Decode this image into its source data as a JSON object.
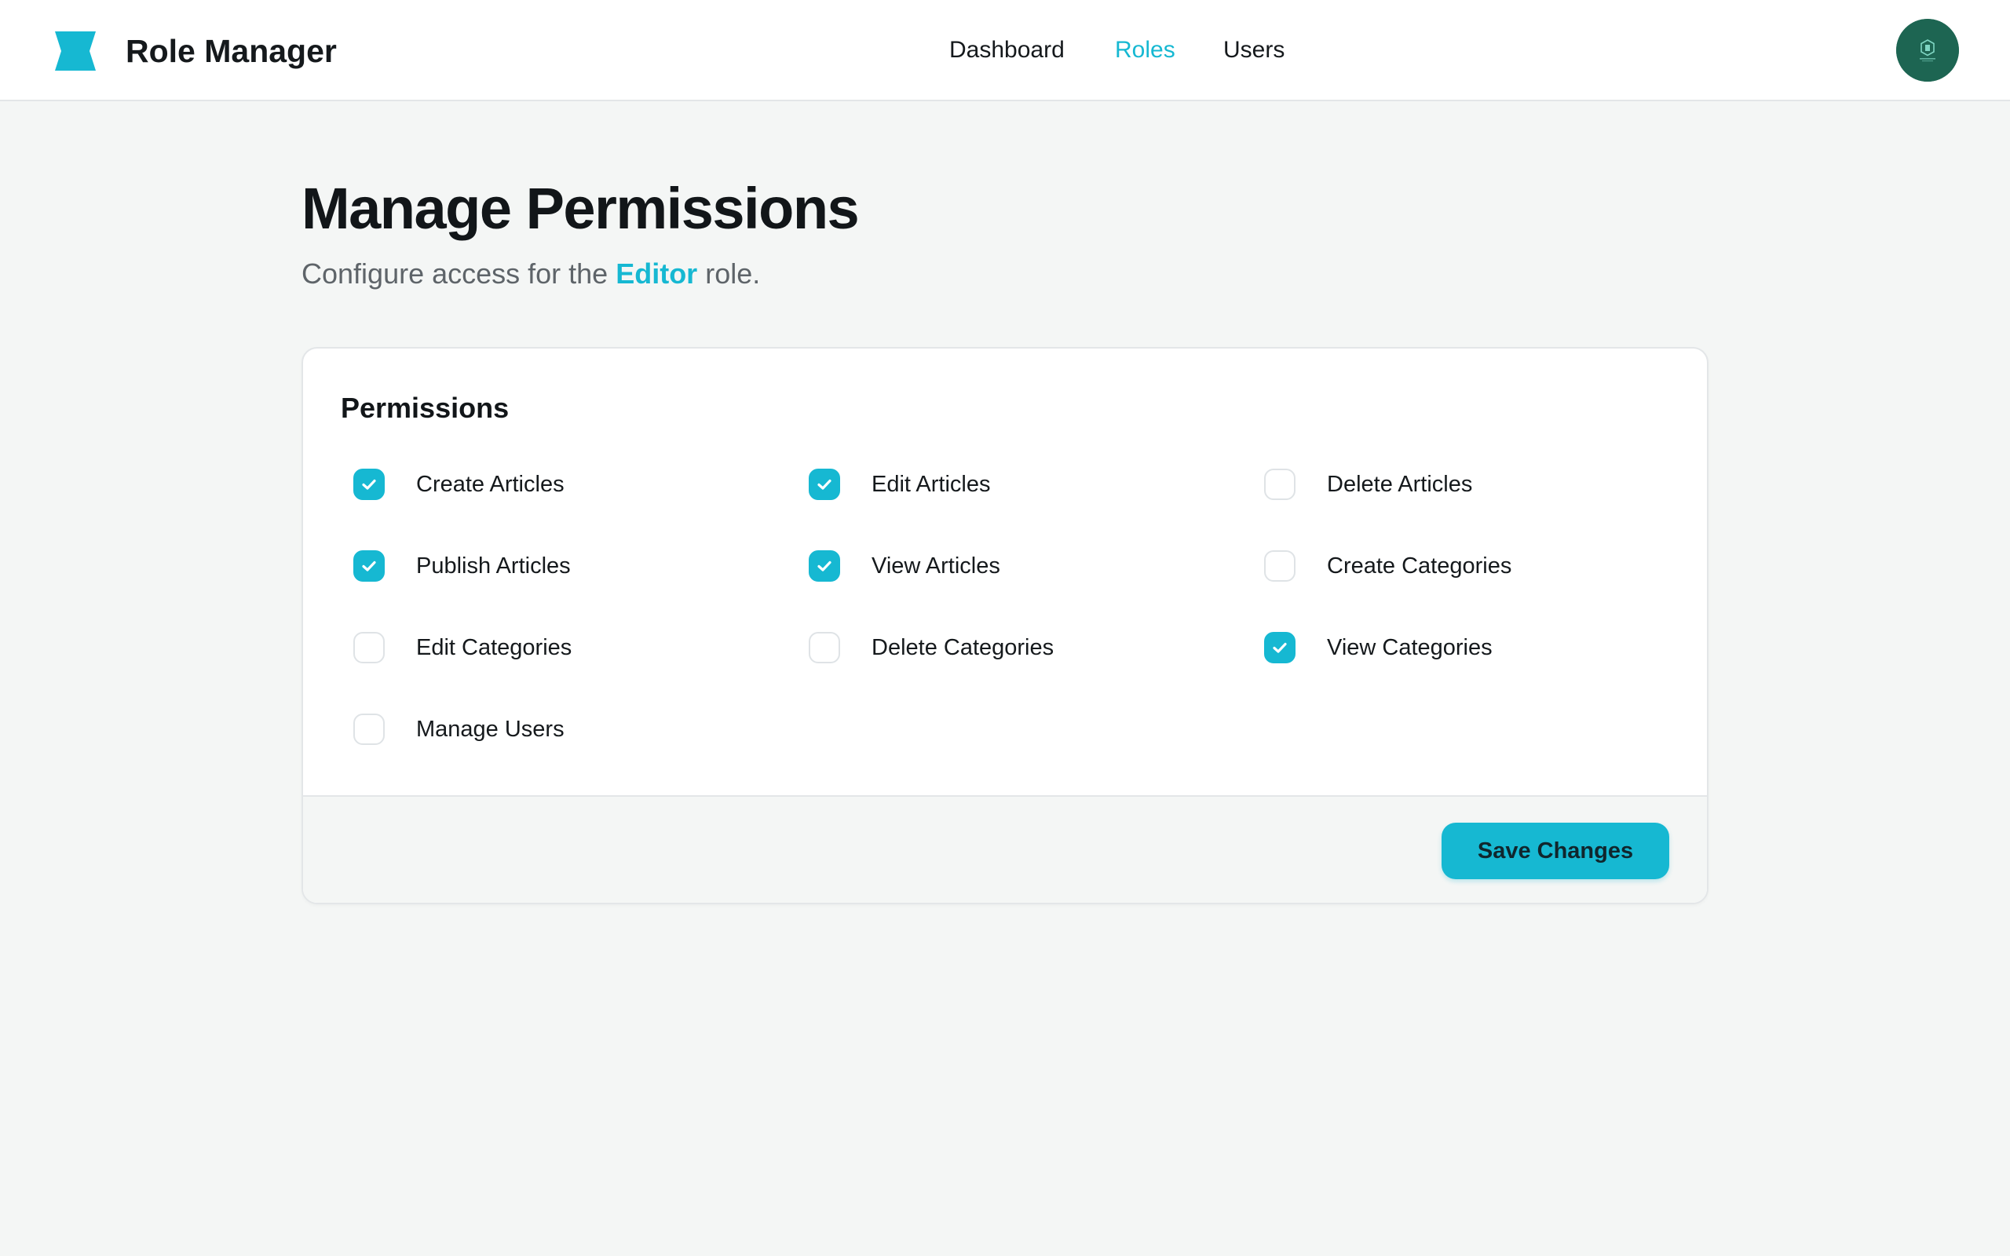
{
  "app": {
    "title": "Role Manager",
    "accent_color": "#16b8d2",
    "logo_icon": "bowtie-logo-icon",
    "avatar_color": "#1d6552"
  },
  "nav": {
    "items": [
      {
        "label": "Dashboard",
        "active": false
      },
      {
        "label": "Roles",
        "active": true
      },
      {
        "label": "Users",
        "active": false
      }
    ]
  },
  "page": {
    "title": "Manage Permissions",
    "subtitle_prefix": "Configure access for the ",
    "role_name": "Editor",
    "subtitle_suffix": " role."
  },
  "permissions": {
    "heading": "Permissions",
    "items": [
      {
        "label": "Create Articles",
        "checked": true
      },
      {
        "label": "Edit Articles",
        "checked": true
      },
      {
        "label": "Delete Articles",
        "checked": false
      },
      {
        "label": "Publish Articles",
        "checked": true
      },
      {
        "label": "View Articles",
        "checked": true
      },
      {
        "label": "Create Categories",
        "checked": false
      },
      {
        "label": "Edit Categories",
        "checked": false
      },
      {
        "label": "Delete Categories",
        "checked": false
      },
      {
        "label": "View Categories",
        "checked": true
      },
      {
        "label": "Manage Users",
        "checked": false
      }
    ]
  },
  "actions": {
    "save_label": "Save Changes"
  }
}
